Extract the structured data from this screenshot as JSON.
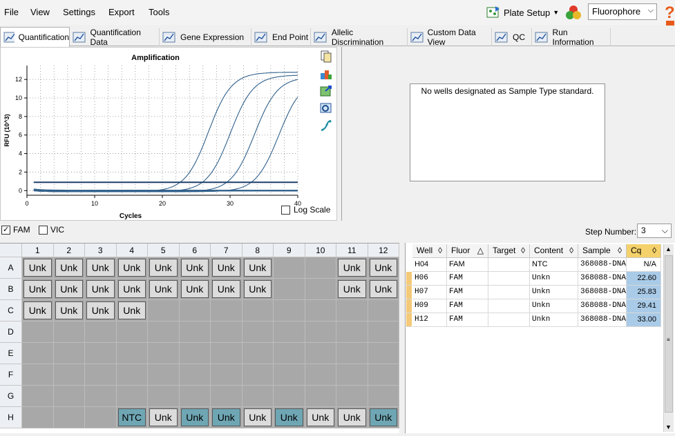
{
  "menu": [
    "File",
    "View",
    "Settings",
    "Export",
    "Tools"
  ],
  "toolbar": {
    "plate_setup": "Plate Setup",
    "fluorophore": "Fluorophore"
  },
  "tabs": [
    {
      "label": "Quantification",
      "icon": "amplification-icon",
      "active": true
    },
    {
      "label": "Quantification Data",
      "icon": "quant-data-icon",
      "active": false
    },
    {
      "label": "Gene Expression",
      "icon": "bar-chart-icon",
      "active": false
    },
    {
      "label": "End Point",
      "icon": "end-point-icon",
      "active": false
    },
    {
      "label": "Allelic Discrimination",
      "icon": "scatter-icon",
      "active": false
    },
    {
      "label": "Custom Data View",
      "icon": "gear-icon",
      "active": false
    },
    {
      "label": "QC",
      "icon": "check-icon",
      "active": false
    },
    {
      "label": "Run Information",
      "icon": "document-icon",
      "active": false
    }
  ],
  "chart_data": {
    "type": "line",
    "title": "Amplification",
    "xlabel": "Cycles",
    "ylabel": "RFU (10^3)",
    "xlim": [
      0,
      40
    ],
    "ylim": [
      -0.5,
      13.5
    ],
    "xticks": [
      0,
      10,
      20,
      30,
      40
    ],
    "yticks": [
      0,
      2,
      4,
      6,
      8,
      10,
      12
    ],
    "grid": true,
    "threshold": 0.9,
    "curves": [
      {
        "cq": 22.6,
        "max": 12.9
      },
      {
        "cq": 25.83,
        "max": 12.6
      },
      {
        "cq": 29.41,
        "max": 12.4
      },
      {
        "cq": 33.0,
        "max": 12.2
      }
    ],
    "flat_lines": 3
  },
  "log_scale_label": "Log Scale",
  "right_message": "No wells designated as Sample Type standard.",
  "fluor": {
    "fam": "FAM",
    "vic": "VIC",
    "step_label": "Step Number:",
    "step_value": "3"
  },
  "plate": {
    "cols": [
      "1",
      "2",
      "3",
      "4",
      "5",
      "6",
      "7",
      "8",
      "9",
      "10",
      "11",
      "12"
    ],
    "rows": [
      "A",
      "B",
      "C",
      "D",
      "E",
      "F",
      "G",
      "H"
    ],
    "wells": [
      [
        "Unk",
        "Unk",
        "Unk",
        "Unk",
        "Unk",
        "Unk",
        "Unk",
        "Unk",
        "",
        "",
        "Unk",
        "Unk"
      ],
      [
        "Unk",
        "Unk",
        "Unk",
        "Unk",
        "Unk",
        "Unk",
        "Unk",
        "Unk",
        "",
        "",
        "Unk",
        "Unk"
      ],
      [
        "Unk",
        "Unk",
        "Unk",
        "Unk",
        "",
        "",
        "",
        "",
        "",
        "",
        "",
        ""
      ],
      [
        "",
        "",
        "",
        "",
        "",
        "",
        "",
        "",
        "",
        "",
        "",
        ""
      ],
      [
        "",
        "",
        "",
        "",
        "",
        "",
        "",
        "",
        "",
        "",
        "",
        ""
      ],
      [
        "",
        "",
        "",
        "",
        "",
        "",
        "",
        "",
        "",
        "",
        "",
        ""
      ],
      [
        "",
        "",
        "",
        "",
        "",
        "",
        "",
        "",
        "",
        "",
        "",
        ""
      ],
      [
        "",
        "",
        "",
        "NTC",
        "Unk",
        "Unk",
        "Unk",
        "Unk",
        "Unk",
        "Unk",
        "Unk",
        "Unk"
      ]
    ],
    "highlight_h": [
      4,
      6,
      7,
      9,
      12
    ]
  },
  "table": {
    "headers": [
      "Well",
      "Fluor",
      "Target",
      "Content",
      "Sample",
      "Cq"
    ],
    "rows": [
      [
        "H04",
        "FAM",
        "",
        "NTC",
        "368088-DNA",
        "N/A"
      ],
      [
        "H06",
        "FAM",
        "",
        "Unkn",
        "368088-DNA",
        "22.60"
      ],
      [
        "H07",
        "FAM",
        "",
        "Unkn",
        "368088-DNA",
        "25.83"
      ],
      [
        "H09",
        "FAM",
        "",
        "Unkn",
        "368088-DNA",
        "29.41"
      ],
      [
        "H12",
        "FAM",
        "",
        "Unkn",
        "368088-DNA",
        "33.00"
      ]
    ]
  }
}
